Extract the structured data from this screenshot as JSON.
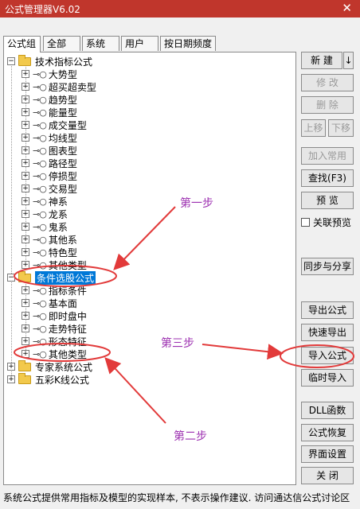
{
  "window": {
    "title": "公式管理器V6.02",
    "close_glyph": "✕"
  },
  "tabs": [
    "公式组",
    "全部",
    "系统",
    "用户",
    "按日期频度"
  ],
  "tree": [
    {
      "label": "技术指标公式",
      "type": "folder",
      "expanded": true,
      "children": [
        "大势型",
        "超买超卖型",
        "趋势型",
        "能量型",
        "成交量型",
        "均线型",
        "图表型",
        "路径型",
        "停损型",
        "交易型",
        "神系",
        "龙系",
        "鬼系",
        "其他系",
        "特色型",
        "其他类型"
      ]
    },
    {
      "label": "条件选股公式",
      "type": "folder",
      "expanded": true,
      "selected": true,
      "children": [
        "指标条件",
        "基本面",
        "即时盘中",
        "走势特征",
        "形态特征",
        "其他类型"
      ]
    },
    {
      "label": "专家系统公式",
      "type": "folder",
      "expanded": false,
      "children": []
    },
    {
      "label": "五彩K线公式",
      "type": "folder",
      "expanded": false,
      "children": []
    }
  ],
  "buttons": {
    "new": "新 建",
    "new_arrow": "↓",
    "edit": "修 改",
    "delete": "删 除",
    "move_up": "上移",
    "move_down": "下移",
    "add_common": "加入常用",
    "find": "查找(F3)",
    "preview": "预 览",
    "linked_preview": "关联预览",
    "sync_share": "同步与分享",
    "export": "导出公式",
    "quick_export": "快速导出",
    "import": "导入公式",
    "temp_import": "临时导入",
    "dll": "DLL函数",
    "restore": "公式恢复",
    "ui_settings": "界面设置",
    "close": "关 闭"
  },
  "status_text": "系统公式提供常用指标及模型的实现样本, 不表示操作建议. 访问通达信公式讨论区",
  "annotations": {
    "step1": "第一步",
    "step2": "第二步",
    "step3": "第三步"
  },
  "colors": {
    "title_bar": "#c0362c",
    "annotation": "#9c2fb0",
    "arrow": "#e23a3a",
    "selection": "#0078d7"
  }
}
